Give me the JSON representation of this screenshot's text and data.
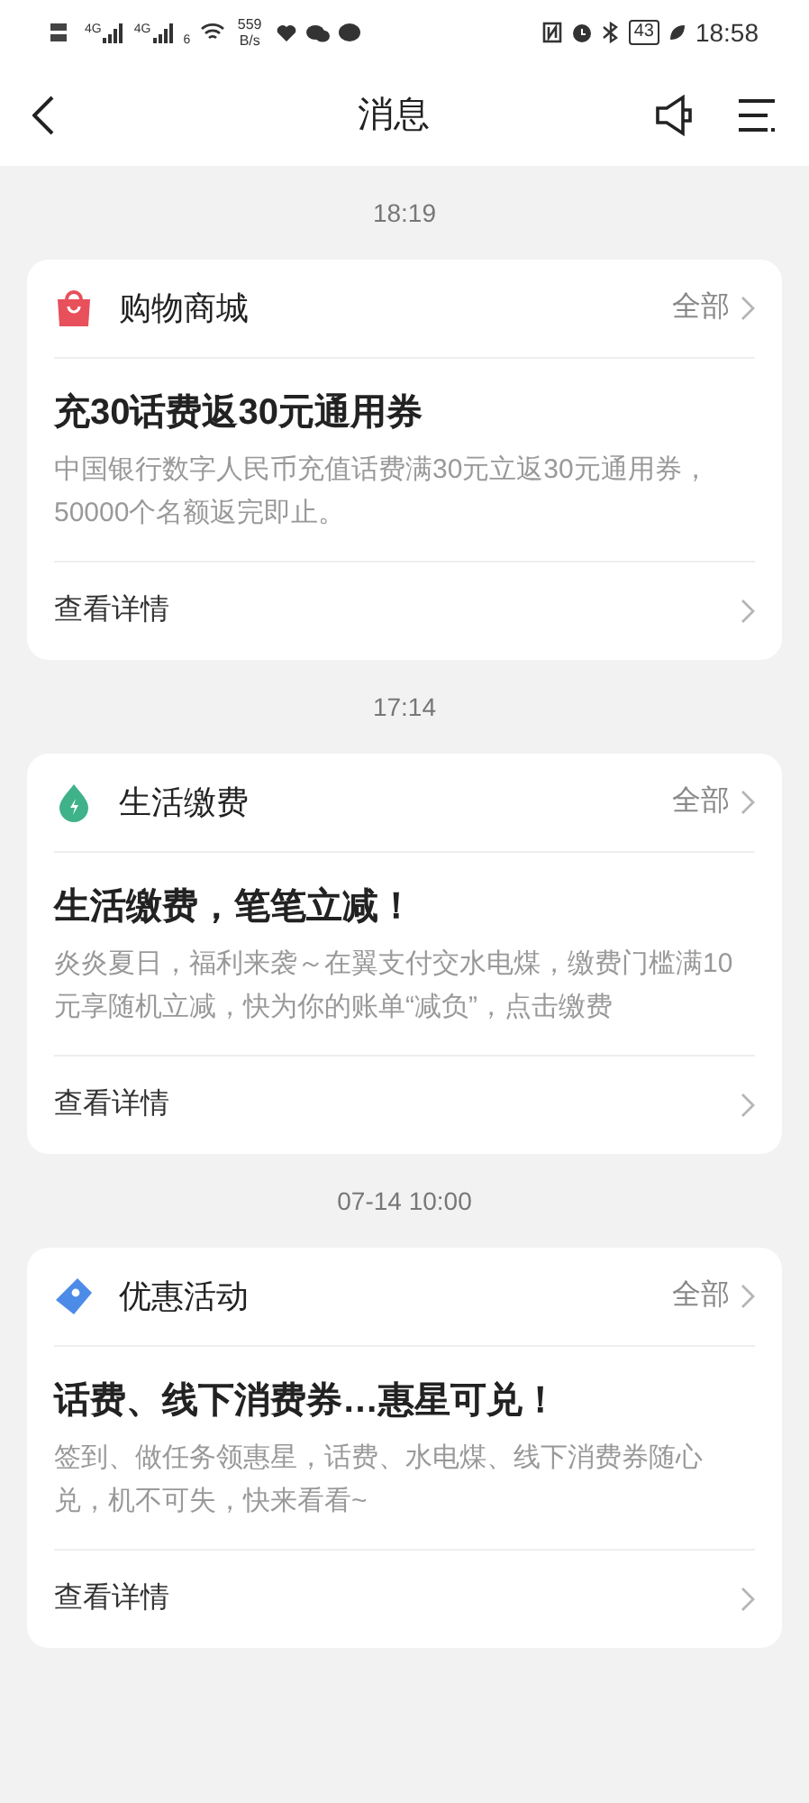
{
  "status_bar": {
    "signal_labels": [
      "4G",
      "4G"
    ],
    "wifi_label": "6",
    "speed_value": "559",
    "speed_unit": "B/s",
    "battery": "43",
    "time": "18:58"
  },
  "header": {
    "title": "消息"
  },
  "groups": [
    {
      "time": "18:19",
      "card": {
        "kind": "bag",
        "category": "购物商城",
        "all_label": "全部",
        "title": "充30话费返30元通用券",
        "body": "中国银行数字人民币充值话费满30元立返30元通用券，50000个名额返完即止。",
        "details_label": "查看详情"
      }
    },
    {
      "time": "17:14",
      "card": {
        "kind": "drop",
        "category": "生活缴费",
        "all_label": "全部",
        "title": "生活缴费，笔笔立减！",
        "body": "炎炎夏日，福利来袭～在翼支付交水电煤，缴费门槛满10元享随机立减，快为你的账单“减负”，点击缴费",
        "details_label": "查看详情"
      }
    },
    {
      "time": "07-14 10:00",
      "card": {
        "kind": "tag",
        "category": "优惠活动",
        "all_label": "全部",
        "title": "话费、线下消费券…惠星可兑！",
        "body": "签到、做任务领惠星，话费、水电煤、线下消费券随心兑，机不可失，快来看看~",
        "details_label": "查看详情"
      }
    }
  ]
}
